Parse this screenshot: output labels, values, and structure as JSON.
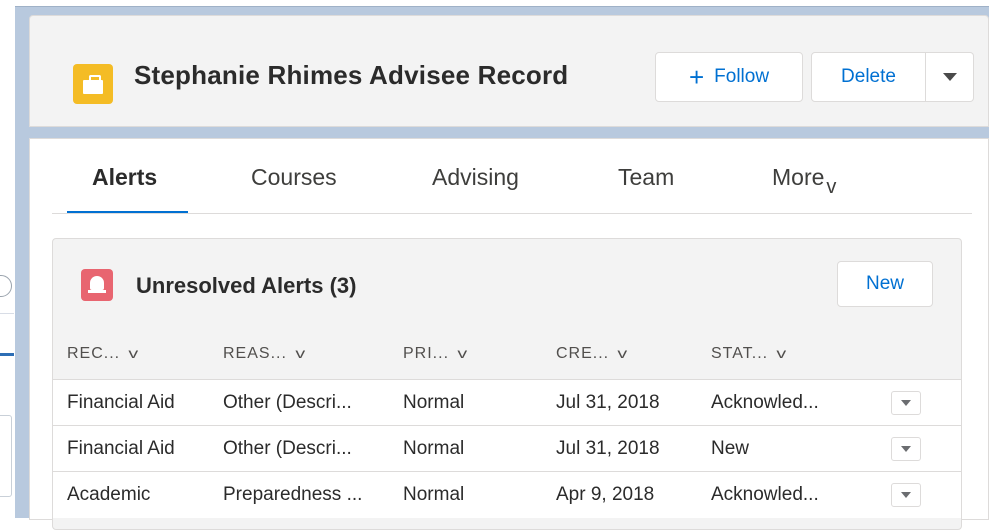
{
  "record": {
    "title": "Stephanie Rhimes Advisee Record",
    "icon": "briefcase-icon",
    "actions": {
      "follow_label": "Follow",
      "delete_label": "Delete"
    }
  },
  "tabs": [
    {
      "label": "Alerts",
      "active": true
    },
    {
      "label": "Courses",
      "active": false
    },
    {
      "label": "Advising",
      "active": false
    },
    {
      "label": "Team",
      "active": false
    },
    {
      "label": "More",
      "active": false
    }
  ],
  "alerts": {
    "title": "Unresolved Alerts (3)",
    "icon": "bell-icon",
    "new_label": "New",
    "columns": [
      "REC...",
      "REAS...",
      "PRI...",
      "CRE...",
      "STAT..."
    ],
    "rows": [
      [
        "Financial Aid",
        "Other (Descri...",
        "Normal",
        "Jul 31, 2018",
        "Acknowled..."
      ],
      [
        "Financial Aid",
        "Other (Descri...",
        "Normal",
        "Jul 31, 2018",
        "New"
      ],
      [
        "Academic",
        "Preparedness ...",
        "Normal",
        "Apr 9, 2018",
        "Acknowled..."
      ]
    ]
  },
  "colors": {
    "accent": "#0070d2",
    "record_icon": "#f4bc25",
    "alert_icon": "#e86570"
  }
}
